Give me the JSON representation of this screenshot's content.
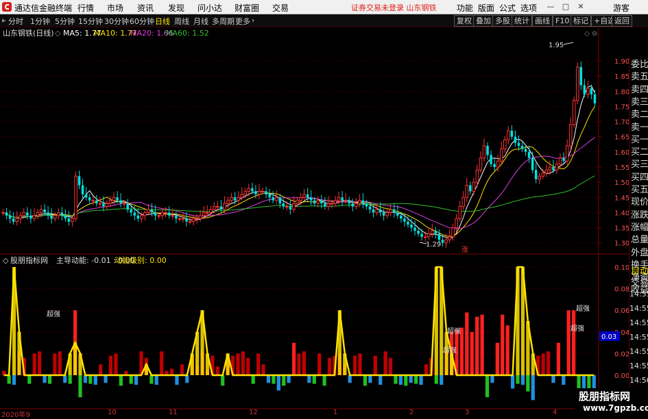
{
  "app": {
    "title": "通达信金融终端"
  },
  "menu": {
    "items": [
      "行情",
      "市场",
      "资讯",
      "发现",
      "问小达",
      "财富圈",
      "交易"
    ]
  },
  "notice": "证券交易未登录  山东钢铁",
  "menu_right": {
    "items": [
      "功能",
      "版面",
      "公式",
      "选项"
    ],
    "guest": "游客"
  },
  "periods": {
    "items": [
      "分时",
      "1分钟",
      "5分钟",
      "15分钟",
      "30分钟",
      "60分钟",
      "日线",
      "周线",
      "月线",
      "多周期",
      "更多"
    ],
    "active": "日线"
  },
  "toolbar": {
    "items": [
      "复权",
      "叠加",
      "多股",
      "统计",
      "画线",
      "F10",
      "标记",
      "+自选",
      "返回"
    ]
  },
  "main_chart": {
    "stock_label": "山东钢铁(日线)",
    "ma": [
      {
        "label": "MA5: 1.77",
        "color": "#ffffff"
      },
      {
        "label": "MA10: 1.77",
        "color": "#ffe300"
      },
      {
        "label": "MA20: 1.66",
        "color": "#e040e0"
      },
      {
        "label": "MA60: 1.52",
        "color": "#30c030"
      }
    ],
    "high_label": "1.95",
    "low_label": "1.29",
    "limit_up_tag": "涨",
    "y_ticks": [
      "1.90",
      "1.85",
      "1.80",
      "1.75",
      "1.70",
      "1.65",
      "1.60",
      "1.55",
      "1.50",
      "1.45",
      "1.40",
      "1.35",
      "1.30"
    ]
  },
  "sub_chart": {
    "label": "股朋指标网",
    "main_force": "主导动能: -0.01 : 0.00",
    "level": "动能级别: 0.00",
    "peak_tag": "超强",
    "current_value": "0.03",
    "y_ticks": [
      "0.10",
      "0.08",
      "0.06",
      "0.04",
      "0.02",
      "0.00"
    ]
  },
  "side_panel": {
    "items": [
      "委比",
      "卖五",
      "卖四",
      "卖三",
      "卖二",
      "卖一",
      "买一",
      "买二",
      "买三",
      "买四",
      "买五",
      "现价",
      "涨跌",
      "涨幅",
      "总量",
      "外盘",
      "换手",
      "净资",
      "收益"
    ],
    "sub_items": [
      "自动",
      "交易"
    ],
    "times": [
      "14:55",
      "14:55",
      "14:55",
      "14:55",
      "14:55",
      "14:55",
      "14:56",
      "14:56"
    ]
  },
  "x_axis": {
    "labels": [
      "2020年9",
      "10",
      "11",
      "12",
      "1",
      "2",
      "3",
      "4"
    ]
  },
  "watermark": {
    "line1": "股朋指标网",
    "line2": "www.7gpzb.com"
  },
  "colors": {
    "up": "#ff3232",
    "down": "#00e0e0",
    "brand": "#d4201c"
  },
  "chart_data": {
    "type": "candlestick",
    "title": "山东钢铁(日线)",
    "ylim": [
      1.27,
      1.97
    ],
    "y_ticks": [
      1.3,
      1.35,
      1.4,
      1.45,
      1.5,
      1.55,
      1.6,
      1.65,
      1.7,
      1.75,
      1.8,
      1.85,
      1.9
    ],
    "close": [
      1.4,
      1.39,
      1.38,
      1.37,
      1.38,
      1.39,
      1.4,
      1.39,
      1.38,
      1.39,
      1.4,
      1.41,
      1.4,
      1.39,
      1.38,
      1.39,
      1.4,
      1.39,
      1.38,
      1.37,
      1.38,
      1.52,
      1.49,
      1.46,
      1.45,
      1.44,
      1.44,
      1.43,
      1.43,
      1.42,
      1.43,
      1.44,
      1.45,
      1.44,
      1.43,
      1.43,
      1.41,
      1.4,
      1.39,
      1.38,
      1.39,
      1.4,
      1.41,
      1.4,
      1.39,
      1.39,
      1.4,
      1.4,
      1.39,
      1.39,
      1.38,
      1.38,
      1.38,
      1.37,
      1.37,
      1.38,
      1.38,
      1.39,
      1.4,
      1.4,
      1.41,
      1.42,
      1.42,
      1.41,
      1.43,
      1.44,
      1.45,
      1.44,
      1.45,
      1.46,
      1.47,
      1.48,
      1.47,
      1.46,
      1.47,
      1.47,
      1.46,
      1.45,
      1.44,
      1.45,
      1.43,
      1.42,
      1.42,
      1.41,
      1.43,
      1.44,
      1.45,
      1.46,
      1.45,
      1.44,
      1.43,
      1.44,
      1.43,
      1.42,
      1.43,
      1.43,
      1.44,
      1.45,
      1.44,
      1.44,
      1.43,
      1.42,
      1.43,
      1.44,
      1.43,
      1.42,
      1.41,
      1.4,
      1.41,
      1.4,
      1.39,
      1.4,
      1.41,
      1.4,
      1.39,
      1.38,
      1.37,
      1.36,
      1.35,
      1.34,
      1.33,
      1.32,
      1.32,
      1.33,
      1.34,
      1.33,
      1.31,
      1.3,
      1.31,
      1.32,
      1.35,
      1.38,
      1.42,
      1.45,
      1.49,
      1.47,
      1.5,
      1.54,
      1.58,
      1.62,
      1.59,
      1.56,
      1.55,
      1.57,
      1.61,
      1.64,
      1.67,
      1.65,
      1.63,
      1.62,
      1.61,
      1.6,
      1.58,
      1.54,
      1.51,
      1.52,
      1.53,
      1.54,
      1.55,
      1.54,
      1.56,
      1.58,
      1.57,
      1.62,
      1.69,
      1.77,
      1.88,
      1.82,
      1.79,
      1.81,
      1.79,
      1.76
    ],
    "volume_strength": [
      0.0,
      0.0,
      0.1,
      0.04,
      0.0,
      0.0,
      0.0,
      0.0,
      0.0,
      0.0,
      0.0,
      0.0,
      0.0,
      0.02,
      0.03,
      0.02,
      0.0,
      0.0,
      0.0,
      0.0,
      0.0,
      0.0,
      0.0,
      0.0,
      0.0,
      0.0,
      0.0,
      0.0,
      0.01,
      0.0,
      0.0,
      0.0,
      0.0,
      0.0,
      0.0,
      0.0,
      0.0,
      0.02,
      0.04,
      0.06,
      0.02,
      0.0,
      0.0,
      0.0,
      0.02,
      0.0,
      0.0,
      0.0,
      0.0,
      0.0,
      0.0,
      0.0,
      0.0,
      0.0,
      0.0,
      0.0,
      0.0,
      0.0,
      0.0,
      0.0,
      0.0,
      0.0,
      0.0,
      0.0,
      0.0,
      0.0,
      0.06,
      0.02,
      0.0,
      0.0,
      0.0,
      0.0,
      0.0,
      0.0,
      0.0,
      0.0,
      0.0,
      0.0,
      0.0,
      0.0,
      0.0,
      0.0,
      0.0,
      0.0,
      0.0,
      0.1,
      0.1,
      0.04,
      0.02,
      0.0,
      0.0,
      0.0,
      0.0,
      0.0,
      0.0,
      0.0,
      0.0,
      0.0,
      0.0,
      0.0,
      0.0,
      0.1,
      0.1,
      0.05,
      0.02,
      0.0,
      0.0,
      0.0,
      0.0,
      0.0,
      0.0,
      0.0,
      0.0,
      0.0,
      0.0,
      0.0,
      0.0
    ]
  }
}
